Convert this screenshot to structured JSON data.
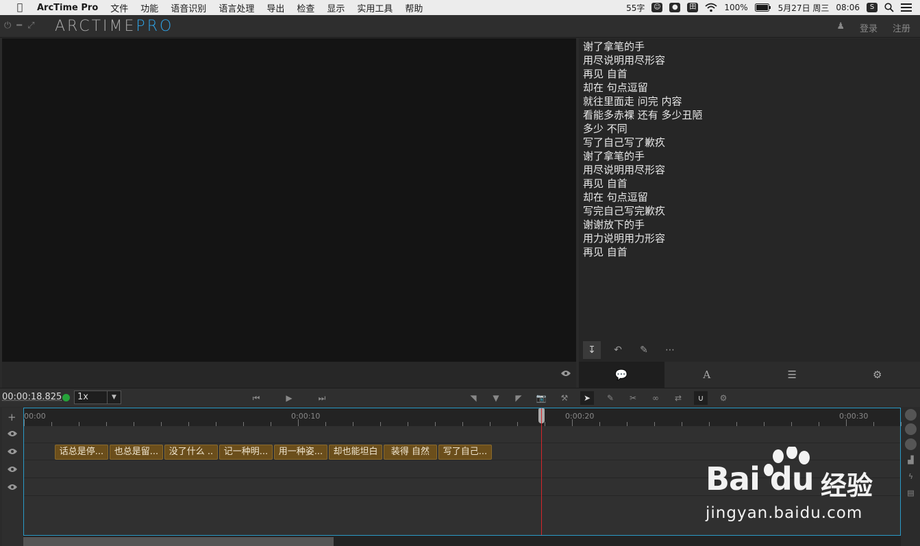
{
  "menubar": {
    "app_name": "ArcTime Pro",
    "items": [
      "文件",
      "功能",
      "语音识别",
      "语言处理",
      "导出",
      "检查",
      "显示",
      "实用工具",
      "帮助"
    ],
    "status": {
      "chars": "55字",
      "battery": "100%",
      "date": "5月27日 周三",
      "time": "08:06"
    }
  },
  "titlebar": {
    "logo_main": "ARCTIME",
    "logo_accent": "PRO",
    "login": "登录",
    "register": "注册"
  },
  "subtitle_lines": [
    "谢了拿笔的手",
    "用尽说明用尽形容",
    "再见 自首",
    "却在 句点逗留",
    "就往里面走 问完 内容",
    "看能多赤裸 还有 多少丑陋",
    "多少 不同",
    "写了自己写了歉疚",
    "谢了拿笔的手",
    "用尽说明用尽形容",
    "再见 自首",
    "却在 句点逗留",
    "写完自己写完歉疚",
    "谢谢放下的手",
    "用力说明用力形容",
    "再见 自首"
  ],
  "controls": {
    "timecode": "00:00:18.825",
    "speed": "1x"
  },
  "timeline": {
    "ruler_labels": [
      "00:00",
      "0:00:10",
      "0:00:20",
      "0:00:30"
    ],
    "clips": [
      "话总是停...",
      "也总是留...",
      "没了什么 ..",
      "记一种明...",
      "用一种姿...",
      "却也能坦白",
      "装得 自然",
      "写了自己..."
    ]
  },
  "watermark": {
    "brand": "Bai du",
    "brand_cn": "经验",
    "url": "jingyan.baidu.com"
  },
  "colors": {
    "accent": "#2ea4e8",
    "clip": "#6b4e1b",
    "playhead": "#d8262a",
    "status_ok": "#26a33a"
  }
}
